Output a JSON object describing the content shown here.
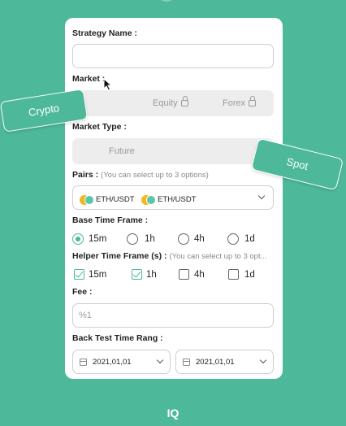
{
  "form": {
    "strategy_name_label": "Strategy Name :",
    "strategy_name_value": "",
    "market_label": "Market :",
    "market_options": [
      {
        "label": "Equity",
        "locked": true
      },
      {
        "label": "Forex",
        "locked": true
      }
    ],
    "market_type_label": "Market Type :",
    "market_type_option": "Future",
    "pairs_label": "Pairs :",
    "pairs_hint": "(You can select up to 3 options)",
    "pairs_selected": [
      "ETH/USDT",
      "ETH/USDT"
    ],
    "base_tf_label": "Base Time Frame :",
    "base_tf_options": [
      "15m",
      "1h",
      "4h",
      "1d"
    ],
    "base_tf_selected": "15m",
    "helper_tf_label": "Helper Time Frame (s) :",
    "helper_tf_hint": "(You can select up to 3 opt...",
    "helper_tf_options": [
      "15m",
      "1h",
      "4h",
      "1d"
    ],
    "helper_tf_checked": [
      "15m",
      "1h"
    ],
    "fee_label": "Fee :",
    "fee_placeholder": "%1",
    "backtest_label": "Back Test Time Rang :",
    "backtest_start": "2021,01,01",
    "backtest_end": "2021,01,01"
  },
  "floating": {
    "crypto_label": "Crypto",
    "spot_label": "Spot"
  },
  "footer": {
    "brand": "IQ"
  },
  "colors": {
    "accent": "#4db99a",
    "background": "#4db99a",
    "card": "#ffffff"
  },
  "icons": [
    "lock-icon",
    "coin-icon",
    "chevron-down-icon",
    "calendar-icon",
    "cursor-icon"
  ]
}
